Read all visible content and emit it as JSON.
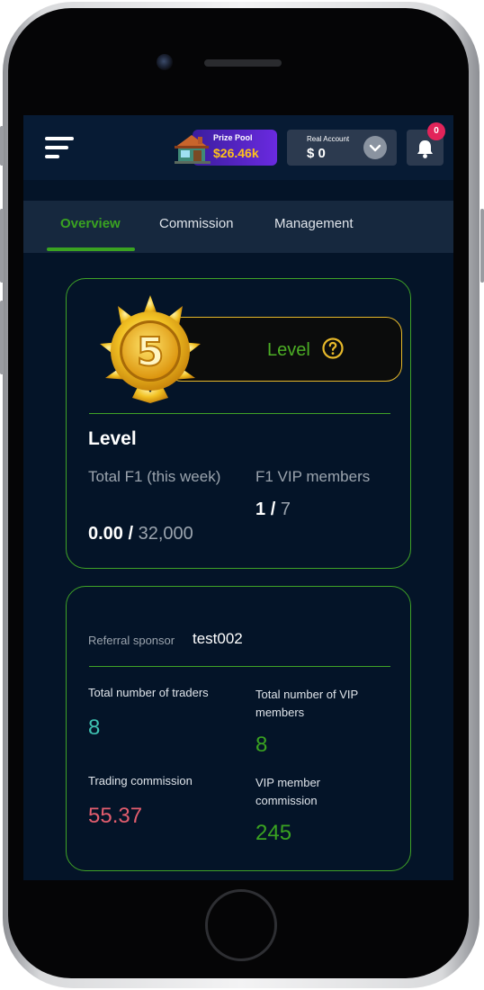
{
  "header": {
    "prize_pool_title": "Prize Pool",
    "prize_pool_value": "$26.46k",
    "account_label": "Real Account",
    "account_value": "$ 0",
    "notification_count": "0"
  },
  "tabs": [
    {
      "label": "Overview",
      "active": true
    },
    {
      "label": "Commission",
      "active": false
    },
    {
      "label": "Management",
      "active": false
    }
  ],
  "level_card": {
    "medal_number": "5",
    "pill_label": "Level",
    "heading": "Level",
    "total_f1_label": "Total F1 (this week)",
    "total_f1_current": "0.00",
    "total_f1_separator": "/",
    "total_f1_target": "32,000",
    "vip_label": "F1 VIP members",
    "vip_current": "1",
    "vip_separator": "/",
    "vip_target": "7"
  },
  "stats_card": {
    "sponsor_label": "Referral sponsor",
    "sponsor_value": "test002",
    "traders_label": "Total number of traders",
    "traders_value": "8",
    "vip_count_label": "Total number of VIP members",
    "vip_count_value": "8",
    "trading_commission_label": "Trading commission",
    "trading_commission_value": "55.37",
    "vip_commission_label": "VIP member commission",
    "vip_commission_value": "245"
  },
  "colors": {
    "accent_green": "#3aa321",
    "pink_value": "#e25d6e",
    "teal_value": "#3ec0b0",
    "gold": "#e6b82a",
    "background": "#041428"
  },
  "icons": [
    "menu-icon",
    "prize-house-icon",
    "chevron-down-icon",
    "bell-icon",
    "medal-icon",
    "help-icon"
  ]
}
